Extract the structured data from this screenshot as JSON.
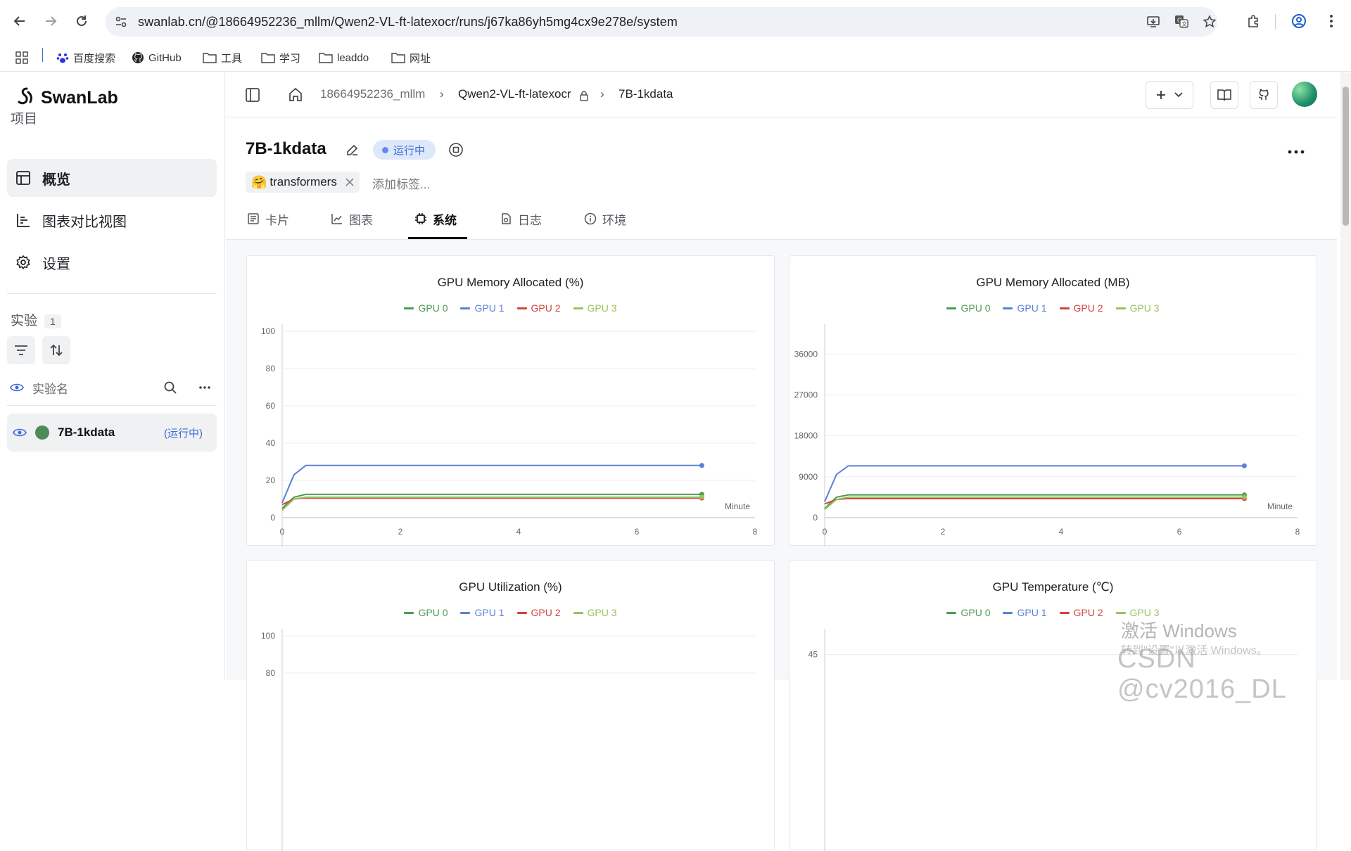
{
  "browser": {
    "url": "swanlab.cn/@18664952236_mllm/Qwen2-VL-ft-latexocr/runs/j67ka86yh5mg4cx9e278e/system",
    "bookmarks": [
      "百度搜索",
      "GitHub",
      "工具",
      "学习",
      "leaddo",
      "网址"
    ]
  },
  "sidebar": {
    "logo": "SwanLab",
    "project_section": "项目",
    "items": [
      {
        "label": "概览",
        "icon": "table-icon"
      },
      {
        "label": "图表对比视图",
        "icon": "chart-compare-icon"
      },
      {
        "label": "设置",
        "icon": "gear-icon"
      }
    ],
    "experiments_section": "实验",
    "experiments_count": "1",
    "exp_column_label": "实验名",
    "experiments": [
      {
        "name": "7B-1kdata",
        "status": "(运行中)",
        "color": "#4e8a57"
      }
    ]
  },
  "topbar": {
    "crumbs": [
      "18664952236_mllm",
      "Qwen2-VL-ft-latexocr",
      "7B-1kdata"
    ]
  },
  "run": {
    "title": "7B-1kdata",
    "status": "运行中",
    "tag": "transformers",
    "add_tag_placeholder": "添加标签..."
  },
  "tabs": [
    {
      "label": "卡片",
      "icon": "card-icon"
    },
    {
      "label": "图表",
      "icon": "line-chart-icon"
    },
    {
      "label": "系统",
      "icon": "chip-icon"
    },
    {
      "label": "日志",
      "icon": "log-icon"
    },
    {
      "label": "环境",
      "icon": "info-icon"
    }
  ],
  "active_tab": 2,
  "colors": {
    "gpu0": "#4e9a52",
    "gpu1": "#5b80d6",
    "gpu2": "#d0453e",
    "gpu3": "#98c25c",
    "accent": "#3e6ad6"
  },
  "chart_data": [
    {
      "type": "line",
      "title": "GPU Memory Allocated (%)",
      "xlabel": "Minute",
      "xlim": [
        0,
        8
      ],
      "ylim": [
        0,
        100
      ],
      "xticks": [
        0,
        2,
        4,
        6,
        8
      ],
      "yticks": [
        0,
        20,
        40,
        60,
        80,
        100
      ],
      "series": [
        {
          "name": "GPU 0",
          "x": [
            0,
            0.2,
            0.4,
            7.1
          ],
          "y": [
            5,
            11,
            12.5,
            12.5
          ]
        },
        {
          "name": "GPU 1",
          "x": [
            0,
            0.2,
            0.4,
            7.1
          ],
          "y": [
            8,
            23,
            28,
            28
          ]
        },
        {
          "name": "GPU 2",
          "x": [
            0,
            0.2,
            0.4,
            7.1
          ],
          "y": [
            7,
            10,
            10.5,
            10.5
          ]
        },
        {
          "name": "GPU 3",
          "x": [
            0,
            0.2,
            0.4,
            7.1
          ],
          "y": [
            4,
            10,
            11,
            11
          ]
        }
      ]
    },
    {
      "type": "line",
      "title": "GPU Memory Allocated (MB)",
      "xlabel": "Minute",
      "xlim": [
        0,
        8
      ],
      "ylim": [
        0,
        41000
      ],
      "xticks": [
        0,
        2,
        4,
        6,
        8
      ],
      "yticks": [
        0,
        9000,
        18000,
        27000,
        36000
      ],
      "series": [
        {
          "name": "GPU 0",
          "x": [
            0,
            0.2,
            0.4,
            7.1
          ],
          "y": [
            2000,
            4500,
            5000,
            5000
          ]
        },
        {
          "name": "GPU 1",
          "x": [
            0,
            0.2,
            0.4,
            7.1
          ],
          "y": [
            3500,
            9500,
            11400,
            11400
          ]
        },
        {
          "name": "GPU 2",
          "x": [
            0,
            0.2,
            0.4,
            7.1
          ],
          "y": [
            3000,
            4000,
            4200,
            4200
          ]
        },
        {
          "name": "GPU 3",
          "x": [
            0,
            0.2,
            0.4,
            7.1
          ],
          "y": [
            1800,
            4000,
            4500,
            4500
          ]
        }
      ]
    },
    {
      "type": "line",
      "title": "GPU Utilization (%)",
      "xlabel": "",
      "ylim": [
        0,
        100
      ],
      "yticks": [
        80,
        100
      ],
      "series": [
        {
          "name": "GPU 0",
          "x": [],
          "y": []
        },
        {
          "name": "GPU 1",
          "x": [],
          "y": []
        },
        {
          "name": "GPU 2",
          "x": [],
          "y": []
        },
        {
          "name": "GPU 3",
          "x": [],
          "y": []
        }
      ]
    },
    {
      "type": "line",
      "title": "GPU Temperature (℃)",
      "xlabel": "",
      "yticks": [
        45
      ],
      "series": [
        {
          "name": "GPU 0",
          "x": [],
          "y": []
        },
        {
          "name": "GPU 1",
          "x": [],
          "y": []
        },
        {
          "name": "GPU 2",
          "x": [],
          "y": []
        },
        {
          "name": "GPU 3",
          "x": [],
          "y": []
        }
      ]
    }
  ],
  "watermark": {
    "line1": "激活 Windows",
    "line2": "转到\"设置\"以激活 Windows。",
    "csdn": "CSDN @cv2016_DL"
  }
}
